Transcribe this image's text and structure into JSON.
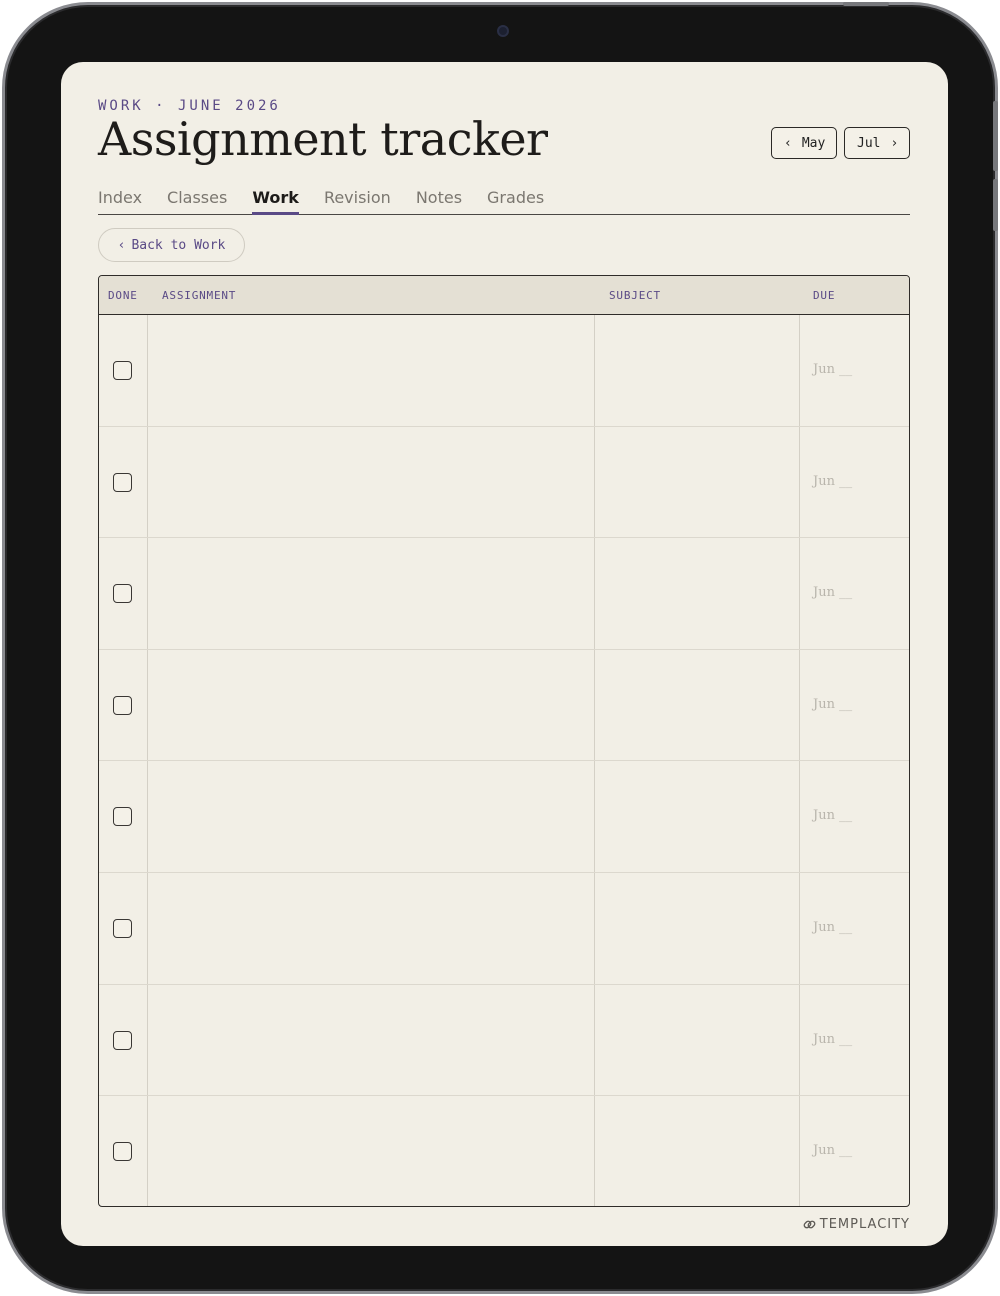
{
  "header": {
    "kicker": "WORK · JUNE 2026",
    "title": "Assignment tracker",
    "prev_month": "May",
    "next_month": "Jul",
    "prev_chevron": "‹",
    "next_chevron": "›"
  },
  "tabs": [
    {
      "label": "Index"
    },
    {
      "label": "Classes"
    },
    {
      "label": "Work",
      "active": true
    },
    {
      "label": "Revision"
    },
    {
      "label": "Notes"
    },
    {
      "label": "Grades"
    }
  ],
  "back_button": {
    "chevron": "‹",
    "label": "Back to Work"
  },
  "table": {
    "columns": [
      "DONE",
      "ASSIGNMENT",
      "SUBJECT",
      "DUE"
    ],
    "rows": [
      {
        "done": false,
        "assignment": "",
        "subject": "",
        "due": "Jun __"
      },
      {
        "done": false,
        "assignment": "",
        "subject": "",
        "due": "Jun __"
      },
      {
        "done": false,
        "assignment": "",
        "subject": "",
        "due": "Jun __"
      },
      {
        "done": false,
        "assignment": "",
        "subject": "",
        "due": "Jun __"
      },
      {
        "done": false,
        "assignment": "",
        "subject": "",
        "due": "Jun __"
      },
      {
        "done": false,
        "assignment": "",
        "subject": "",
        "due": "Jun __"
      },
      {
        "done": false,
        "assignment": "",
        "subject": "",
        "due": "Jun __"
      },
      {
        "done": false,
        "assignment": "",
        "subject": "",
        "due": "Jun __"
      }
    ]
  },
  "footer": {
    "brand": "TEMPLACITY",
    "brand_icon": "link-icon"
  },
  "colors": {
    "accent": "#5a4a86",
    "paper": "#f2efe6",
    "header_bg": "#e4e0d4",
    "ink": "#1e1c1a"
  }
}
